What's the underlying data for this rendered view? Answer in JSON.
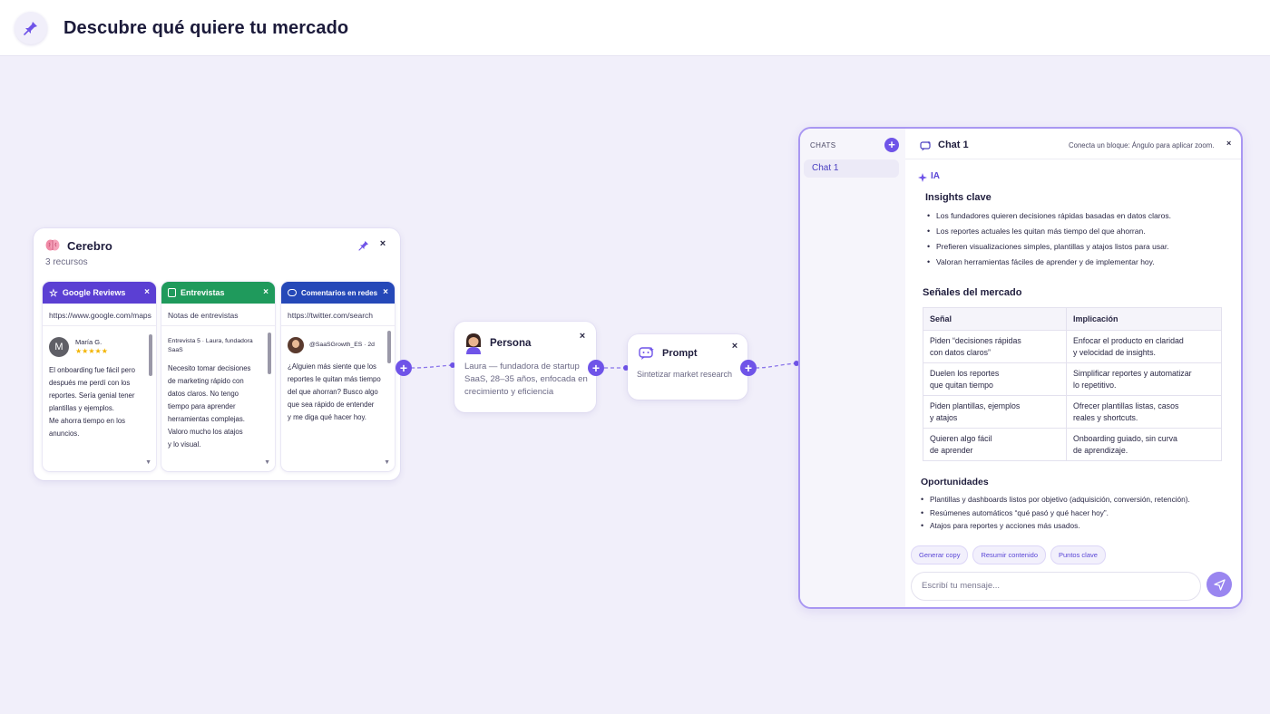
{
  "header": {
    "title": "Descubre qué quiere tu mercado"
  },
  "cerebro": {
    "title": "Cerebro",
    "subtitle": "3 recursos",
    "resources": [
      {
        "name": "Google Reviews",
        "color": "#5b3fd3",
        "url": "https://www.google.com/maps",
        "reviewer_initial": "M",
        "reviewer": "María G.",
        "rating": "★★★★★",
        "text_lines": [
          "El onboarding fue fácil pero",
          "después me perdí con los",
          "reportes. Sería genial tener",
          "plantillas y ejemplos.",
          "Me ahorra tiempo en los",
          "anuncios."
        ]
      },
      {
        "name": "Entrevistas",
        "color": "#1f9a5c",
        "url": "Notas de entrevistas",
        "meta": "Entrevista 5 · Laura, fundadora SaaS",
        "text_lines": [
          "Necesito tomar decisiones",
          "de marketing rápido con",
          "datos claros. No tengo",
          "tiempo para aprender",
          "herramientas complejas.",
          "Valoro mucho los atajos",
          "y lo visual."
        ]
      },
      {
        "name": "Comentarios en redes",
        "color": "#2548b8",
        "url": "https://twitter.com/search",
        "handle": "@SaaSGrowth_ES · 2d",
        "text_lines": [
          "¿Alguien más siente que los",
          "reportes le quitan más tiempo",
          "del que ahorran? Busco algo",
          "que sea rápido de entender",
          "y me diga qué hacer hoy."
        ]
      }
    ]
  },
  "persona": {
    "title": "Persona",
    "description": "Laura — fundadora de startup SaaS, 28–35 años, enfocada en crecimiento y eficiencia"
  },
  "prompt": {
    "title": "Prompt",
    "description": "Sintetizar market research"
  },
  "chat": {
    "sidebar_label": "CHATS",
    "active_chat": "Chat 1",
    "title": "Chat 1",
    "hint": "Conecta un bloque: Ángulo para aplicar zoom.",
    "sender": "IA",
    "insights_heading": "Insights clave",
    "insights": [
      "Los fundadores quieren decisiones rápidas basadas en datos claros.",
      "Los reportes actuales les quitan más tiempo del que ahorran.",
      "Prefieren visualizaciones simples, plantillas y atajos listos para usar.",
      "Valoran herramientas fáciles de aprender y de implementar hoy."
    ],
    "signals_heading": "Señales del mercado",
    "table_headers": [
      "Señal",
      "Implicación"
    ],
    "table_rows": [
      [
        "Piden “decisiones rápidas\ncon datos claros”",
        "Enfocar el producto en claridad\ny velocidad de insights."
      ],
      [
        "Duelen los reportes\nque quitan tiempo",
        "Simplificar reportes y automatizar\nlo repetitivo."
      ],
      [
        "Piden plantillas, ejemplos\ny atajos",
        "Ofrecer plantillas listas, casos\nreales y shortcuts."
      ],
      [
        "Quieren algo fácil\nde aprender",
        "Onboarding guiado, sin curva\nde aprendizaje."
      ]
    ],
    "opportunities_heading": "Oportunidades",
    "opportunities": [
      "Plantillas y dashboards listos por objetivo (adquisición, conversión, retención).",
      "Resúmenes automáticos “qué pasó y qué hacer hoy”.",
      "Atajos para reportes y acciones más usados."
    ],
    "chips": [
      "Generar copy",
      "Resumir contenido",
      "Puntos clave"
    ],
    "input_placeholder": "Escribí tu mensaje..."
  }
}
